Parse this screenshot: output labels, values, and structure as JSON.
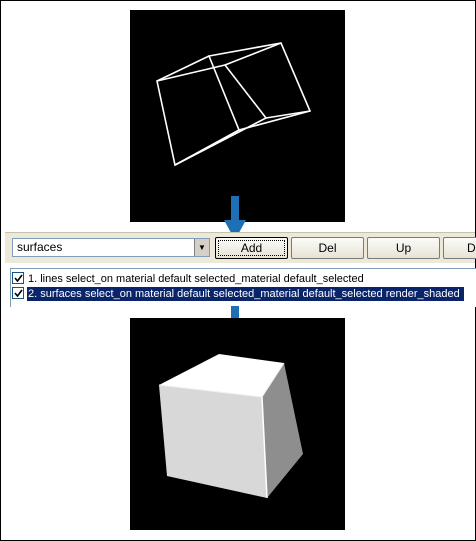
{
  "viewports": {
    "top": {
      "mode": "wireframe",
      "background": "#000000",
      "stroke": "#ffffff"
    },
    "bottom": {
      "mode": "shaded",
      "background": "#000000"
    }
  },
  "arrows": {
    "color": "#1f6fb4"
  },
  "toolbar": {
    "combo_value": "surfaces",
    "add_label": "Add",
    "del_label": "Del",
    "up_label": "Up",
    "down_label": "D"
  },
  "layer_list": {
    "items": [
      {
        "label": "1. lines select_on material default selected_material default_selected",
        "checked": true,
        "selected": false
      },
      {
        "label": "2. surfaces select_on material default selected_material default_selected render_shaded",
        "checked": true,
        "selected": true
      }
    ]
  },
  "colors": {
    "selection": "#0a246a",
    "button_face": "#ece9d8"
  }
}
